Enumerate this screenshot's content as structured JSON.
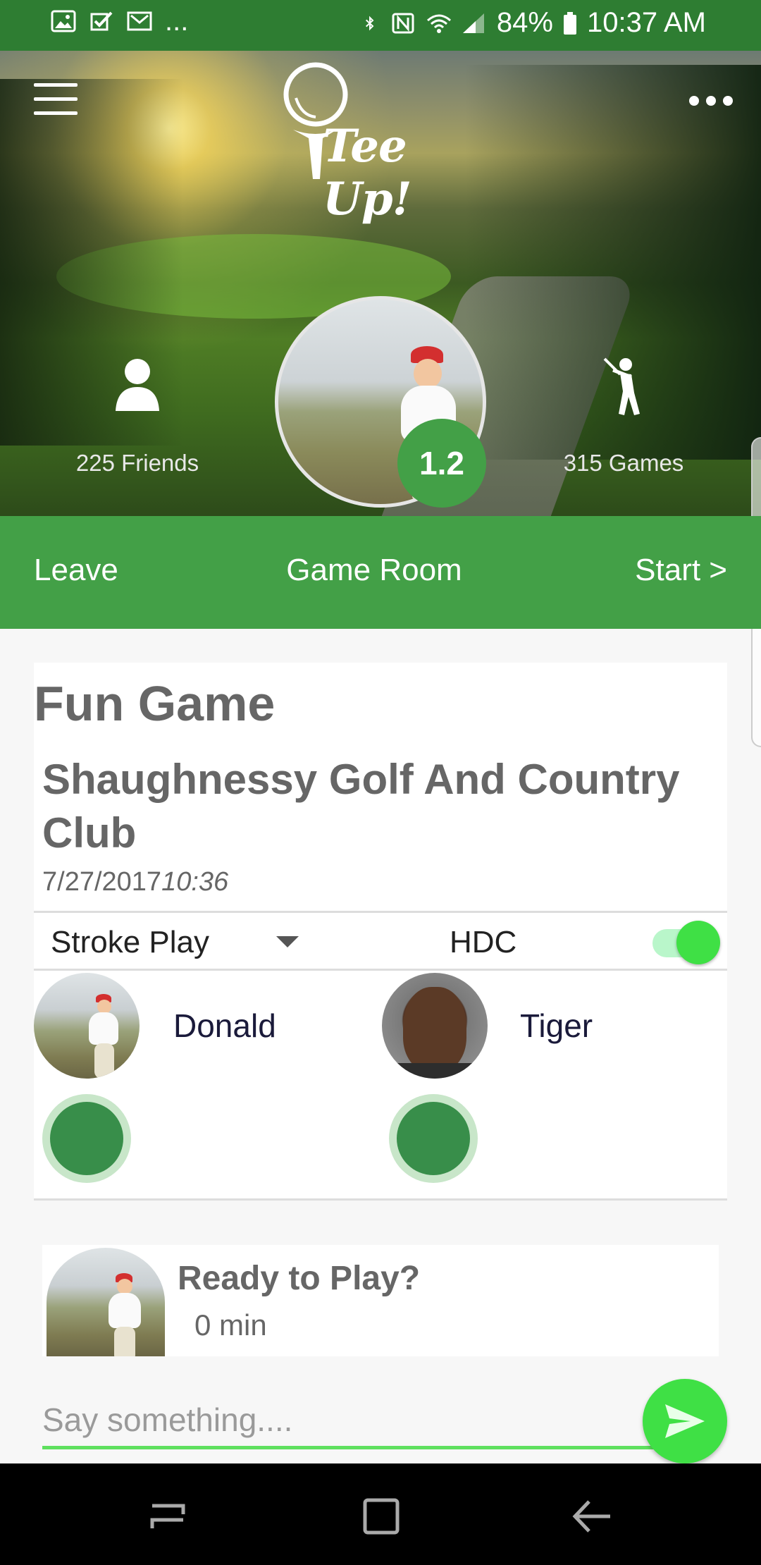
{
  "status_bar": {
    "notif_more": "...",
    "battery": "84%",
    "time": "10:37 AM"
  },
  "header": {
    "app_name": "Tee Up!",
    "friends_label": "225 Friends",
    "games_label": "315 Games",
    "handicap_badge": "1.2"
  },
  "action_bar": {
    "leave_label": "Leave",
    "title": "Game Room",
    "start_label": "Start >"
  },
  "game": {
    "name": "Fun Game",
    "course": "Shaughnessy Golf And Country Club",
    "date": "7/27/2017",
    "time": "10:36",
    "play_type": "Stroke Play",
    "hdc_label": "HDC",
    "hdc_enabled": true,
    "players": [
      {
        "name": "Donald"
      },
      {
        "name": "Tiger"
      }
    ]
  },
  "chat": {
    "message_title": "Ready to Play?",
    "message_time": "0 min",
    "input_placeholder": "Say something...."
  },
  "colors": {
    "status_bar": "#2e7d32",
    "action_bar": "#43a047",
    "accent": "#3fe045",
    "text_gray": "#666666"
  }
}
